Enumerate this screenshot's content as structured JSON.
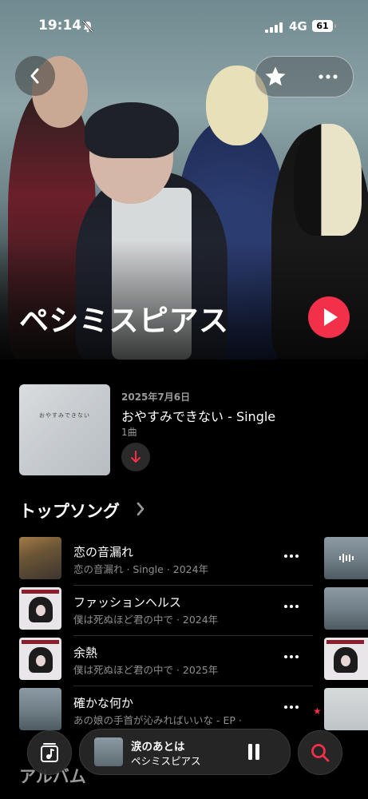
{
  "status": {
    "time": "19:14",
    "network": "4G",
    "battery": "61"
  },
  "artist": {
    "name": "ペシミスピアス"
  },
  "latest_release": {
    "date": "2025年7月6日",
    "title": "おやすみできない - Single",
    "count": "1曲",
    "art_text": "おやすみできない"
  },
  "top_songs": {
    "heading": "トップソング",
    "items": [
      {
        "title": "恋の音漏れ",
        "subtitle": "恋の音漏れ · Single · 2024年"
      },
      {
        "title": "ファッションヘルス",
        "subtitle": "僕は死ぬほど君の中で · 2024年"
      },
      {
        "title": "余熱",
        "subtitle": "僕は死ぬほど君の中で · 2025年"
      },
      {
        "title": "確かな何か",
        "subtitle": "あの娘の手首が沁みればいいな - EP ·"
      }
    ]
  },
  "albums": {
    "heading": "アルバム"
  },
  "now_playing": {
    "title": "涙のあとは",
    "artist": "ペシミスピアス"
  },
  "colors": {
    "accent": "#f2304a",
    "background": "#000000"
  }
}
